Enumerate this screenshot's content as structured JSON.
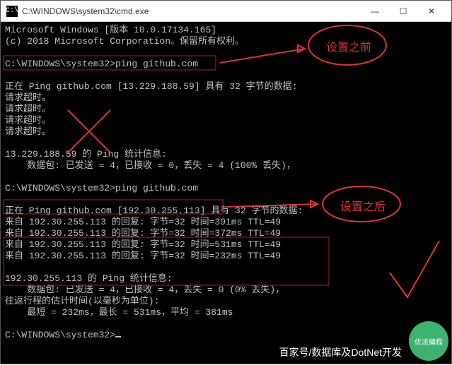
{
  "window": {
    "title": "C:\\WINDOWS\\system32\\cmd.exe",
    "icon": "cmd-icon",
    "buttons": {
      "min": "—",
      "max": "☐",
      "close": "✕"
    }
  },
  "terminal": {
    "line1": "Microsoft Windows [版本 10.0.17134.165]",
    "line2": "(c) 2018 Microsoft Corporation。保留所有权利。",
    "prompt1": "C:\\WINDOWS\\system32>",
    "cmd1": "ping github.com",
    "ping1_header": "正在 Ping github.com [13.229.188.59] 具有 32 字节的数据:",
    "timeout": "请求超时。",
    "stats1_title": "13.229.188.59 的 Ping 统计信息:",
    "stats1_detail": "    数据包: 已发送 = 4，已接收 = 0，丢失 = 4 (100% 丢失)，",
    "prompt2": "C:\\WINDOWS\\system32>",
    "cmd2": "ping github.com",
    "ping2_header": "正在 Ping github.com [192.30.255.113] 具有 32 字节的数据:",
    "reply1": "来自 192.30.255.113 的回复: 字节=32 时间=391ms TTL=49",
    "reply2": "来自 192.30.255.113 的回复: 字节=32 时间=372ms TTL=49",
    "reply3": "来自 192.30.255.113 的回复: 字节=32 时间=531ms TTL=49",
    "reply4": "来自 192.30.255.113 的回复: 字节=32 时间=232ms TTL=49",
    "stats2_title": "192.30.255.113 的 Ping 统计信息:",
    "stats2_detail": "    数据包: 已发送 = 4，已接收 = 4，丢失 = 0 (0% 丢失)，",
    "rtt_title": "往返行程的估计时间(以毫秒为单位):",
    "rtt_detail": "    最短 = 232ms，最长 = 531ms，平均 = 381ms",
    "prompt3": "C:\\WINDOWS\\system32>"
  },
  "annotations": {
    "before": "设置之前",
    "after": "设置之后"
  },
  "watermark": {
    "text": "百家号/数据库及DotNet开发",
    "logo": "优派编程"
  }
}
